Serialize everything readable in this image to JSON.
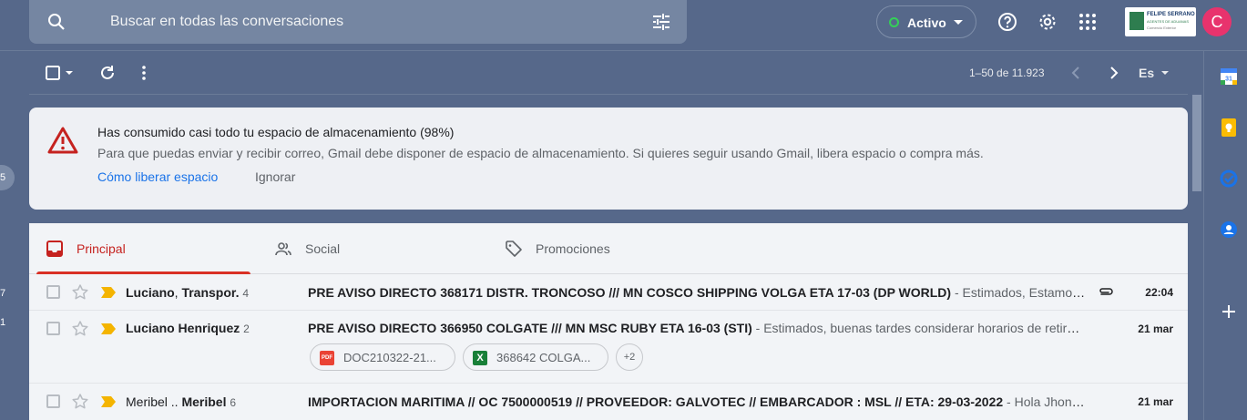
{
  "search": {
    "placeholder": "Buscar en todas las conversaciones"
  },
  "status": {
    "label": "Activo"
  },
  "account": {
    "logo_line1": "FELIPE SERRANO",
    "logo_line2": "AGENTES DE ADUANAS",
    "logo_line3": "Comercio Exterior",
    "avatar_letter": "C"
  },
  "left_fragments": [
    "5",
    "7",
    "1"
  ],
  "toolbar": {
    "pager": "1–50 de 11.923",
    "lang": "Es"
  },
  "banner": {
    "title": "Has consumido casi todo tu espacio de almacenamiento (98%)",
    "description": "Para que puedas enviar y recibir correo, Gmail debe disponer de espacio de almacenamiento. Si quieres seguir usando Gmail, libera espacio o compra más.",
    "link": "Cómo liberar espacio",
    "ignore": "Ignorar"
  },
  "tabs": [
    {
      "label": "Principal",
      "active": true
    },
    {
      "label": "Social"
    },
    {
      "label": "Promociones"
    }
  ],
  "emails": [
    {
      "sender_a": "Luciano",
      "sender_sep": ", ",
      "sender_b": "Transpor.",
      "count": "4",
      "subject": "PRE AVISO DIRECTO 368171 DISTR. TRONCOSO /// MN COSCO SHIPPING VOLGA ETA 17-03 (DP WORLD)",
      "snippet": " - Estimados, Estamos aún esperando documentación",
      "date": "22:04"
    },
    {
      "sender_a": "Luciano Henriquez",
      "count": "2",
      "subject": "PRE AVISO DIRECTO 366950 COLGATE /// MN MSC RUBY ETA 16-03 (STI)",
      "snippet": " - Estimados, buenas tardes considerar horarios de retiro para el",
      "date": "21 mar",
      "attachments": [
        {
          "type": "PDF",
          "name": "DOC210322-21..."
        },
        {
          "type": "X",
          "name": "368642 COLGA..."
        }
      ],
      "more": "+2"
    },
    {
      "sender_a": "Meribel",
      "sender_sep": " .. ",
      "sender_b": "Meribel",
      "count": "6",
      "subject": "IMPORTACION MARITIMA // OC 7500000519 // PROVEEDOR: GALVOTEC // EMBARCADOR : MSL // ETA: 29-03-2022",
      "snippet": " - Hola Jhon, Te envío",
      "date": "21 mar"
    }
  ],
  "colors": {
    "accent_red": "#d93025",
    "link_blue": "#1a73e8",
    "header_bg": "#56688a",
    "active_green": "#34d058"
  }
}
